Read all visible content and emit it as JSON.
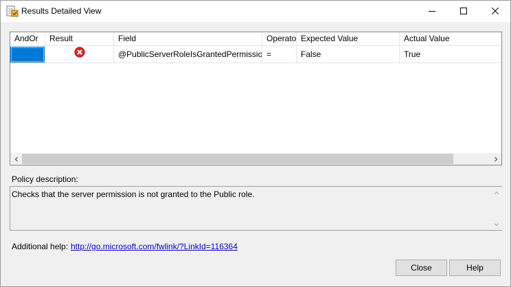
{
  "window": {
    "title": "Results Detailed View",
    "icons": {
      "app": "policy-results-icon",
      "minimize": "minimize-icon",
      "maximize": "maximize-icon",
      "close": "close-icon"
    }
  },
  "grid": {
    "columns": [
      "AndOr",
      "Result",
      "Field",
      "Operator",
      "Expected Value",
      "Actual Value"
    ],
    "rows": [
      {
        "andor": "",
        "result_icon": "error-icon",
        "field": "@PublicServerRoleIsGrantedPermissions",
        "operator": "=",
        "expected": "False",
        "actual": "True"
      }
    ]
  },
  "policy": {
    "label": "Policy description:",
    "text": "Checks that the server permission is not granted to the Public role."
  },
  "help": {
    "label": "Additional help:",
    "link": "http://go.microsoft.com/fwlink/?LinkId=116364"
  },
  "buttons": {
    "close": "Close",
    "help": "Help"
  },
  "colors": {
    "selection": "#0078d7",
    "error": "#d9262a",
    "link": "#0000cc"
  }
}
